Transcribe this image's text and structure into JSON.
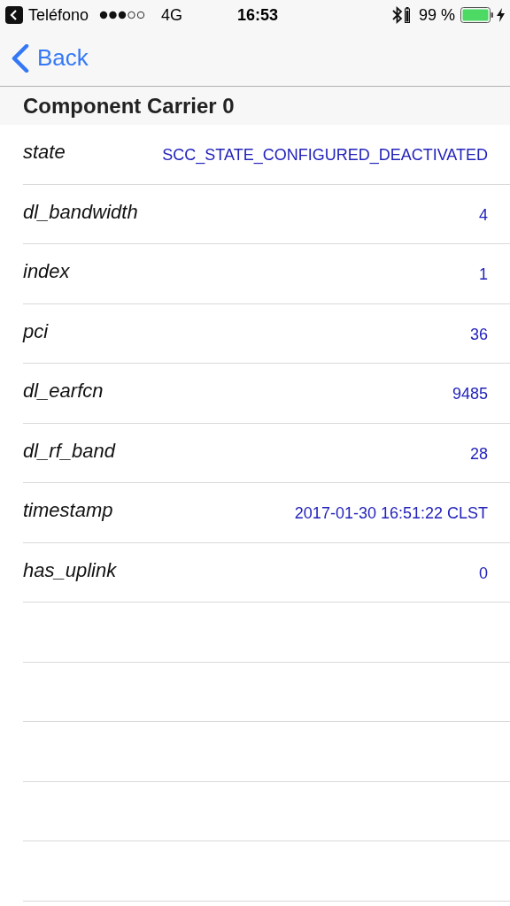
{
  "status_bar": {
    "back_app": "Teléfono",
    "network": "4G",
    "time": "16:53",
    "battery": "99 %"
  },
  "nav": {
    "back": "Back"
  },
  "section": {
    "title": "Component Carrier 0"
  },
  "rows": [
    {
      "label": "state",
      "value": "SCC_STATE_CONFIGURED_DEACTIVATED"
    },
    {
      "label": "dl_bandwidth",
      "value": "4"
    },
    {
      "label": "index",
      "value": "1"
    },
    {
      "label": "pci",
      "value": "36"
    },
    {
      "label": "dl_earfcn",
      "value": "9485"
    },
    {
      "label": "dl_rf_band",
      "value": "28"
    },
    {
      "label": "timestamp",
      "value": "2017-01-30 16:51:22 CLST"
    },
    {
      "label": "has_uplink",
      "value": "0"
    }
  ]
}
